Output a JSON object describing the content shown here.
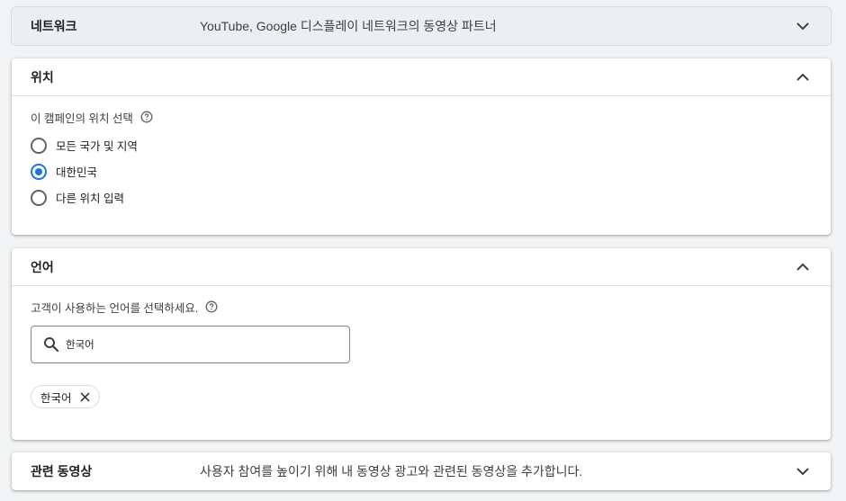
{
  "network_panel": {
    "title": "네트워크",
    "summary": "YouTube, Google 디스플레이 네트워크의 동영상 파트너",
    "chevron_icon": "chevron-down-icon"
  },
  "location_panel": {
    "title": "위치",
    "chevron_icon": "chevron-up-icon",
    "label": "이 캠페인의 위치 선택",
    "help_icon": "help-icon",
    "options": [
      {
        "label": "모든 국가 및 지역",
        "selected": false
      },
      {
        "label": "대한민국",
        "selected": true
      },
      {
        "label": "다른 위치 입력",
        "selected": false
      }
    ]
  },
  "language_panel": {
    "title": "언어",
    "chevron_icon": "chevron-up-icon",
    "label": "고객이 사용하는 언어를 선택하세요.",
    "help_icon": "help-icon",
    "search": {
      "value": "한국어",
      "icon": "search-icon"
    },
    "chips": [
      {
        "label": "한국어",
        "close_icon": "close-icon"
      }
    ]
  },
  "related_videos_panel": {
    "title": "관련 동영상",
    "summary": "사용자 참여를 높이기 위해 내 동영상 광고와 관련된 동영상을 추가합니다.",
    "chevron_icon": "chevron-down-icon"
  },
  "colors": {
    "accent": "#1a73e8",
    "page_background": "#f1f3f4",
    "collapsed_panel_background": "#eceeef"
  }
}
